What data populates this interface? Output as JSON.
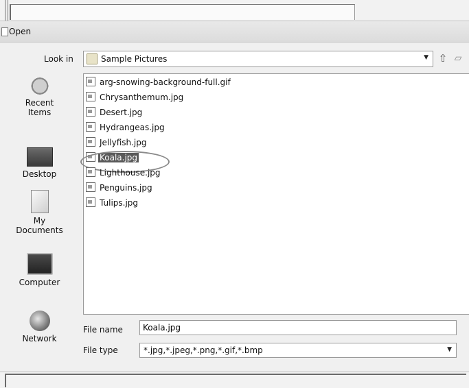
{
  "window": {
    "title": "Open"
  },
  "lookin": {
    "label": "Look in",
    "value": "Sample Pictures",
    "folder_icon": "folder-icon",
    "arrow": "▼"
  },
  "toolbar": {
    "up_icon": "⇧",
    "newfolder_icon": "▱"
  },
  "places": [
    {
      "label": "Recent Items",
      "icon": "recent-items-icon"
    },
    {
      "label": "Desktop",
      "icon": "desktop-icon"
    },
    {
      "label": "My Documents",
      "icon": "documents-icon"
    },
    {
      "label": "Computer",
      "icon": "computer-icon"
    },
    {
      "label": "Network",
      "icon": "network-icon"
    }
  ],
  "files": [
    "arg-snowing-background-full.gif",
    "Chrysanthemum.jpg",
    "Desert.jpg",
    "Hydrangeas.jpg",
    "Jellyfish.jpg",
    "Koala.jpg",
    "Lighthouse.jpg",
    "Penguins.jpg",
    "Tulips.jpg"
  ],
  "selected_file": "Koala.jpg",
  "filename": {
    "label": "File name",
    "value": "Koala.jpg"
  },
  "filetype": {
    "label": "File type",
    "value": "*.jpg,*.jpeg,*.png,*.gif,*.bmp",
    "arrow": "▼"
  }
}
